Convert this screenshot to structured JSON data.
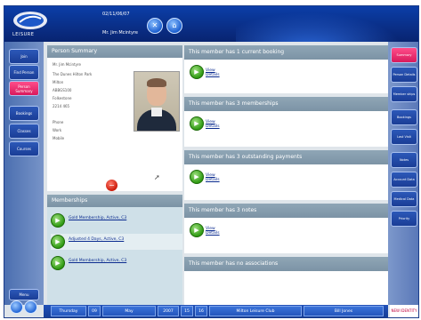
{
  "header": {
    "logo_text": "LEISURE",
    "date": "02/11/06/07",
    "user": "Mr. Jim Mcintyre",
    "btn1_icon": "x-icon",
    "btn2_icon": "home-icon"
  },
  "left_nav": {
    "items": [
      {
        "label": "Join",
        "active": false
      },
      {
        "label": "Find Person",
        "active": false
      },
      {
        "label": "Person Summary",
        "active": true
      },
      {
        "label": "Bookings",
        "active": false
      },
      {
        "label": "Classes",
        "active": false
      },
      {
        "label": "Courses",
        "active": false
      }
    ],
    "menu_label": "Menu"
  },
  "right_nav": {
    "items": [
      {
        "label": "Summary",
        "active": true
      },
      {
        "label": "Person Details",
        "active": false
      },
      {
        "label": "Member ships",
        "active": false
      },
      {
        "label": "Bookings",
        "active": false
      },
      {
        "label": "Last Visit",
        "active": false
      },
      {
        "label": "Notes",
        "active": false
      },
      {
        "label": "Account Data",
        "active": false
      },
      {
        "label": "Medical Data",
        "active": false
      },
      {
        "label": "Priority",
        "active": false
      }
    ],
    "brand": "NEW IDENTITY"
  },
  "summary": {
    "title": "Person Summary",
    "name": "Mr. Jim Mcintyre",
    "address": [
      "The Dunes Hilton Park",
      "Milton",
      "ABBGS100",
      "Folkestone",
      "2214 465"
    ],
    "contact": [
      "Phone",
      "Work",
      "Mobile"
    ]
  },
  "memberships": {
    "title": "Memberships",
    "items": [
      "Gold Membership, Active, C3",
      "Adjusted 4 Days, Active, C3",
      "Gold Membership, Active, C3"
    ]
  },
  "sections": [
    {
      "title": "This member has 1 current booking",
      "link": "View Details"
    },
    {
      "title": "This member has 3 memberships",
      "link": "View Details"
    },
    {
      "title": "This member has 3 outstanding payments",
      "link": "View Details"
    },
    {
      "title": "This member has 3 notes",
      "link": "View Details"
    },
    {
      "title": "This member has no associations",
      "link": ""
    }
  ],
  "footer": {
    "day": "Thursday",
    "date": "09",
    "month": "May",
    "year": "2007",
    "hour": "15",
    "minute": "16",
    "club": "Milton Leisure Club",
    "user": "Bill Jones"
  }
}
